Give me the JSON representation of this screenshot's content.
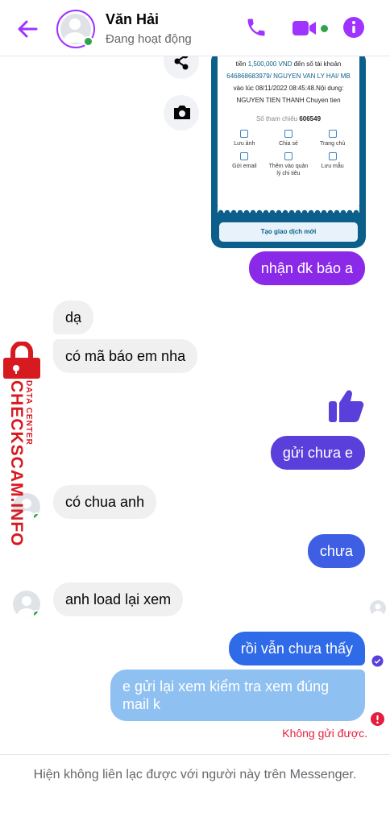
{
  "header": {
    "contact_name": "Văn Hải",
    "status": "Đang hoạt động",
    "accent": "#a033ff"
  },
  "receipt": {
    "line1_prefix": "tiền",
    "amount": "1,500,000 VND",
    "line1_suffix": "đến số tài khoản",
    "account": "646868683979/ NGUYEN VAN LY HAI/ MB",
    "time_line": "vào lúc 08/11/2022 08:45:48.Nội dung:",
    "content": "NGUYEN TIEN THANH Chuyen tien",
    "ref_label": "Số tham chiếu",
    "ref_value": "606549",
    "actions": [
      {
        "label": "Lưu ảnh"
      },
      {
        "label": "Chia sẻ"
      },
      {
        "label": "Trang chủ"
      },
      {
        "label": "Gửi email"
      },
      {
        "label": "Thêm vào quản lý chi tiêu"
      },
      {
        "label": "Lưu mẫu"
      }
    ],
    "new_tx_button": "Tạo giao dịch mới"
  },
  "messages": [
    {
      "text": "nhận đk báo a",
      "dir": "out"
    },
    {
      "text": "dạ",
      "dir": "in"
    },
    {
      "text": "có mã báo em nha",
      "dir": "in"
    },
    {
      "text": "gửi chưa e",
      "dir": "out"
    },
    {
      "text": "có chua anh",
      "dir": "in"
    },
    {
      "text": "chưa",
      "dir": "out"
    },
    {
      "text": "anh load lại xem",
      "dir": "in"
    },
    {
      "text": "rồi vẫn chưa thấy",
      "dir": "out"
    },
    {
      "text": "e gửi lại xem kiểm tra xem đúng mail k",
      "dir": "out",
      "failed": true
    }
  ],
  "error_text": "Không gửi được.",
  "watermark": {
    "site": "CHECKSCAM.INFO",
    "sub": "DATA CENTER"
  },
  "footer": {
    "notice": "Hiện không liên lạc được với người này trên Messenger."
  },
  "icons": [
    "back-arrow-icon",
    "phone-icon",
    "video-call-icon",
    "info-icon",
    "share-icon",
    "camera-icon",
    "thumbs-up-icon",
    "seen-avatar-icon",
    "delivered-check-icon",
    "error-icon",
    "padlock-icon"
  ]
}
